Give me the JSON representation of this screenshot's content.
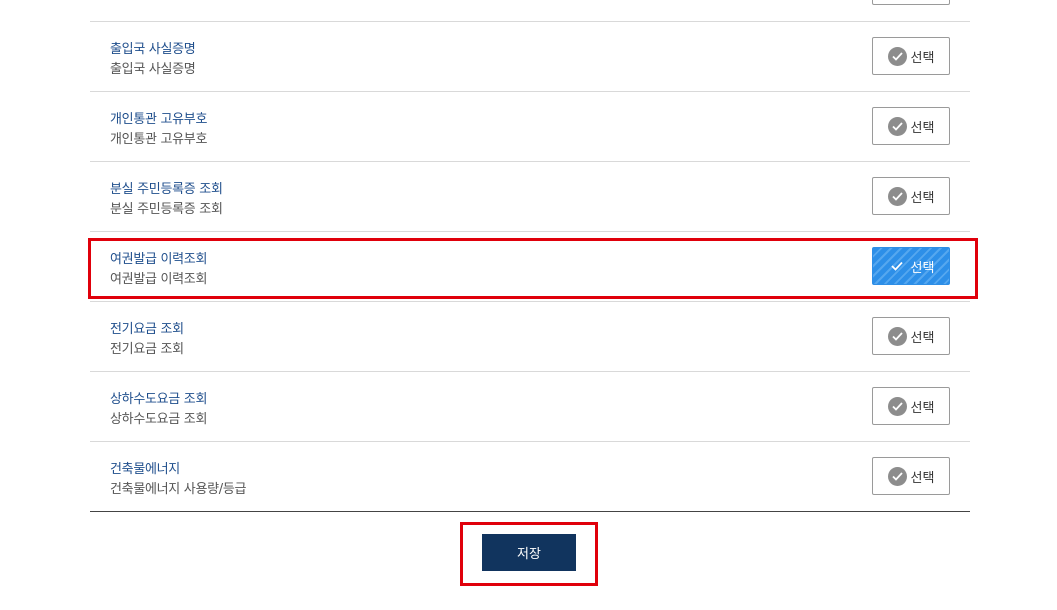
{
  "items": [
    {
      "title": "",
      "desc": "",
      "button": "선택",
      "selected": false
    },
    {
      "title": "출입국 사실증명",
      "desc": "출입국 사실증명",
      "button": "선택",
      "selected": false
    },
    {
      "title": "개인통관 고유부호",
      "desc": "개인통관 고유부호",
      "button": "선택",
      "selected": false
    },
    {
      "title": "분실 주민등록증 조회",
      "desc": "분실 주민등록증 조회",
      "button": "선택",
      "selected": false
    },
    {
      "title": "여권발급 이력조회",
      "desc": "여권발급 이력조회",
      "button": "선택",
      "selected": true
    },
    {
      "title": "전기요금 조회",
      "desc": "전기요금 조회",
      "button": "선택",
      "selected": false
    },
    {
      "title": "상하수도요금 조회",
      "desc": "상하수도요금 조회",
      "button": "선택",
      "selected": false
    },
    {
      "title": "건축물에너지",
      "desc": "건축물에너지 사용량/등급",
      "button": "선택",
      "selected": false
    }
  ],
  "save": {
    "label": "저장"
  },
  "colors": {
    "accent": "#2d8fe8",
    "save_bg": "#11345e",
    "highlight": "#e0000b",
    "title": "#1f4e8c"
  },
  "icons": {
    "check": "check-circle-icon"
  }
}
